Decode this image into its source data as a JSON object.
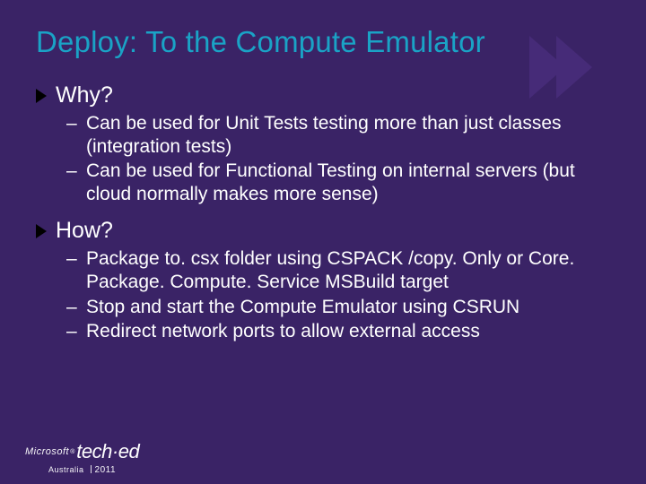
{
  "title": "Deploy: To the Compute Emulator",
  "sections": [
    {
      "heading": "Why?",
      "items": [
        "Can be used for Unit Tests testing more than just classes (integration tests)",
        "Can be used for Functional Testing on internal servers (but cloud normally makes more sense)"
      ]
    },
    {
      "heading": "How?",
      "items": [
        "Package to. csx folder using CSPACK /copy. Only or Core. Package. Compute. Service MSBuild target",
        "Stop and start the Compute Emulator using CSRUN",
        "Redirect network ports to allow external access"
      ]
    }
  ],
  "footer": {
    "brand": "Microsoft",
    "event": "tech·ed",
    "region": "Australia",
    "year": "2011"
  }
}
